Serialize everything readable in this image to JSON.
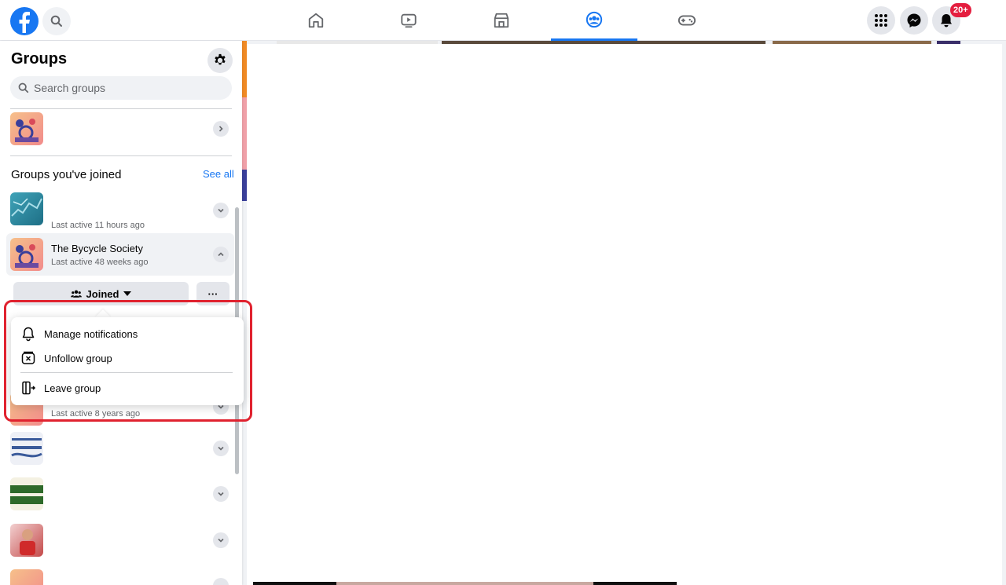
{
  "topbar": {
    "notifications_badge": "20+",
    "nav": [
      "home",
      "watch",
      "marketplace",
      "groups",
      "gaming"
    ],
    "active_nav": "groups"
  },
  "sidebar": {
    "title": "Groups",
    "search_placeholder": "Search groups",
    "section_title": "Groups you've joined",
    "see_all": "See all",
    "rows": [
      {
        "name": "",
        "sub": "Last active 11 hours ago"
      },
      {
        "name": "The Bycycle Society",
        "sub": "Last active 48 weeks ago"
      },
      {
        "name": "",
        "sub": "Last active 8 years ago"
      }
    ],
    "joined_label": "Joined",
    "more_label": "···"
  },
  "dropdown": {
    "items": [
      {
        "label": "Manage notifications",
        "icon": "bell-icon"
      },
      {
        "label": "Unfollow group",
        "icon": "unfollow-icon"
      },
      {
        "label": "Leave group",
        "icon": "leave-icon"
      }
    ]
  },
  "colors": {
    "accent": "#1877f2",
    "highlight_box": "#e0222f",
    "badge": "#e41e3f"
  }
}
